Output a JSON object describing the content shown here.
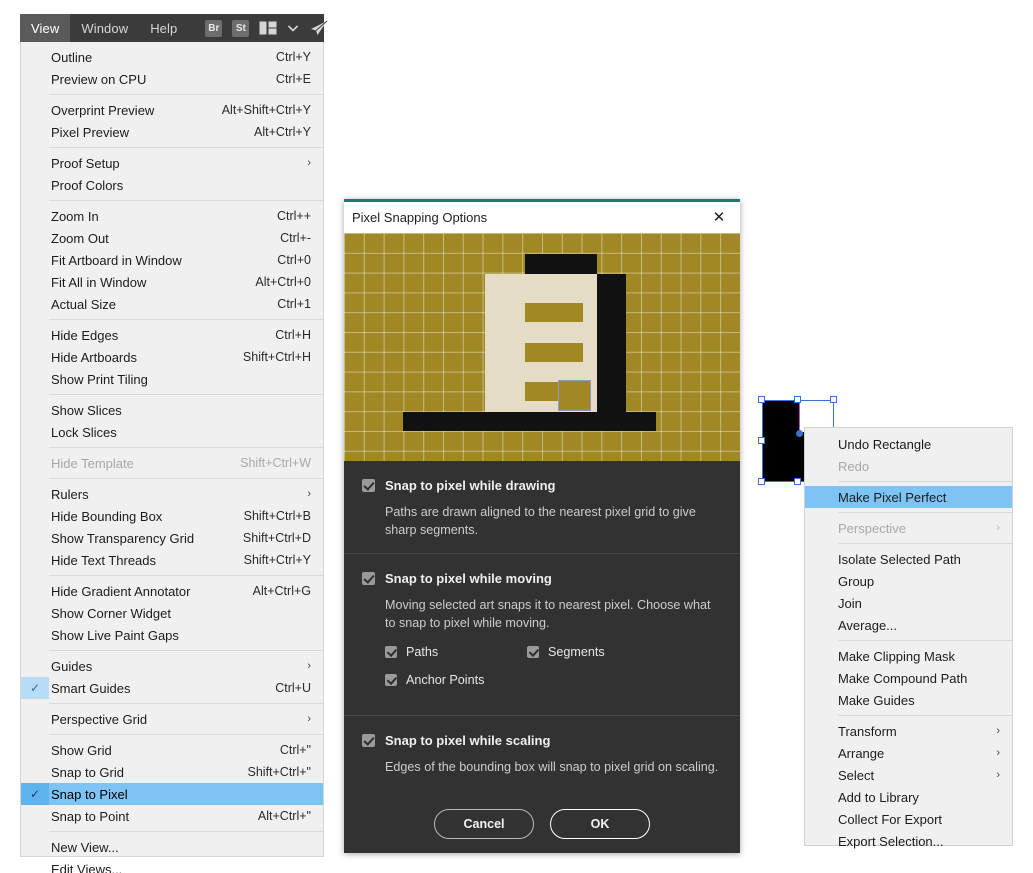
{
  "menubar": {
    "items": [
      {
        "label": "View",
        "active": true
      },
      {
        "label": "Window",
        "active": false
      },
      {
        "label": "Help",
        "active": false
      }
    ],
    "icons": [
      {
        "name": "bridge-icon",
        "label": "Br"
      },
      {
        "name": "stock-icon",
        "label": "St"
      },
      {
        "name": "arrange-documents-icon",
        "label": ""
      },
      {
        "name": "chevron-down-icon",
        "label": "⌄"
      },
      {
        "name": "share-rocket-icon",
        "label": ""
      }
    ]
  },
  "view_menu": {
    "groups": [
      [
        {
          "label": "Outline",
          "accel": "Ctrl+Y"
        },
        {
          "label": "Preview on CPU",
          "accel": "Ctrl+E"
        }
      ],
      [
        {
          "label": "Overprint Preview",
          "accel": "Alt+Shift+Ctrl+Y"
        },
        {
          "label": "Pixel Preview",
          "accel": "Alt+Ctrl+Y"
        }
      ],
      [
        {
          "label": "Proof Setup",
          "accel": "",
          "submenu": true
        },
        {
          "label": "Proof Colors",
          "accel": ""
        }
      ],
      [
        {
          "label": "Zoom In",
          "accel": "Ctrl++"
        },
        {
          "label": "Zoom Out",
          "accel": "Ctrl+-"
        },
        {
          "label": "Fit Artboard in Window",
          "accel": "Ctrl+0"
        },
        {
          "label": "Fit All in Window",
          "accel": "Alt+Ctrl+0"
        },
        {
          "label": "Actual Size",
          "accel": "Ctrl+1"
        }
      ],
      [
        {
          "label": "Hide Edges",
          "accel": "Ctrl+H"
        },
        {
          "label": "Hide Artboards",
          "accel": "Shift+Ctrl+H"
        },
        {
          "label": "Show Print Tiling",
          "accel": ""
        }
      ],
      [
        {
          "label": "Show Slices",
          "accel": ""
        },
        {
          "label": "Lock Slices",
          "accel": ""
        }
      ],
      [
        {
          "label": "Hide Template",
          "accel": "Shift+Ctrl+W",
          "disabled": true
        }
      ],
      [
        {
          "label": "Rulers",
          "accel": "",
          "submenu": true
        },
        {
          "label": "Hide Bounding Box",
          "accel": "Shift+Ctrl+B"
        },
        {
          "label": "Show Transparency Grid",
          "accel": "Shift+Ctrl+D"
        },
        {
          "label": "Hide Text Threads",
          "accel": "Shift+Ctrl+Y"
        }
      ],
      [
        {
          "label": "Hide Gradient Annotator",
          "accel": "Alt+Ctrl+G"
        },
        {
          "label": "Show Corner Widget",
          "accel": ""
        },
        {
          "label": "Show Live Paint Gaps",
          "accel": ""
        }
      ],
      [
        {
          "label": "Guides",
          "accel": "",
          "submenu": true
        },
        {
          "label": "Smart Guides",
          "accel": "Ctrl+U",
          "checked": true
        }
      ],
      [
        {
          "label": "Perspective Grid",
          "accel": "",
          "submenu": true
        }
      ],
      [
        {
          "label": "Show Grid",
          "accel": "Ctrl+\""
        },
        {
          "label": "Snap to Grid",
          "accel": "Shift+Ctrl+\""
        },
        {
          "label": "Snap to Pixel",
          "accel": "",
          "checked": true,
          "selected": true
        },
        {
          "label": "Snap to Point",
          "accel": "Alt+Ctrl+\""
        }
      ],
      [
        {
          "label": "New View...",
          "accel": ""
        },
        {
          "label": "Edit Views...",
          "accel": ""
        }
      ]
    ]
  },
  "dialog": {
    "title": "Pixel Snapping Options",
    "close_label": "✕",
    "sections": [
      {
        "checkbox_label": "Snap to pixel while drawing",
        "checked": true,
        "description": "Paths are drawn aligned to the nearest pixel grid to give sharp segments."
      },
      {
        "checkbox_label": "Snap to pixel while moving",
        "checked": true,
        "description": "Moving selected art snaps it to nearest pixel. Choose what to snap to pixel while moving.",
        "sub_options": [
          {
            "label": "Paths",
            "checked": true
          },
          {
            "label": "Segments",
            "checked": true
          },
          {
            "label": "Anchor Points",
            "checked": true
          }
        ]
      },
      {
        "checkbox_label": "Snap to pixel while scaling",
        "checked": true,
        "description": "Edges of the bounding box will snap to pixel grid on scaling."
      }
    ],
    "buttons": {
      "cancel": "Cancel",
      "ok": "OK"
    },
    "preview": {
      "background_color": "#a08824",
      "grid_line_color": "#ffffff",
      "building_fill": "#e4dcc4",
      "dark_color": "#111111"
    },
    "accent_color": "#1f7a6e"
  },
  "context_menu": {
    "groups": [
      [
        {
          "label": "Undo Rectangle"
        },
        {
          "label": "Redo",
          "disabled": true
        }
      ],
      [
        {
          "label": "Make Pixel Perfect",
          "selected": true
        }
      ],
      [
        {
          "label": "Perspective",
          "disabled": true,
          "submenu": true
        }
      ],
      [
        {
          "label": "Isolate Selected Path"
        },
        {
          "label": "Group"
        },
        {
          "label": "Join"
        },
        {
          "label": "Average..."
        }
      ],
      [
        {
          "label": "Make Clipping Mask"
        },
        {
          "label": "Make Compound Path"
        },
        {
          "label": "Make Guides"
        }
      ],
      [
        {
          "label": "Transform",
          "submenu": true
        },
        {
          "label": "Arrange",
          "submenu": true
        },
        {
          "label": "Select",
          "submenu": true
        },
        {
          "label": "Add to Library"
        },
        {
          "label": "Collect For Export"
        },
        {
          "label": "Export Selection..."
        }
      ]
    ]
  },
  "colors": {
    "menu_background": "#f0f0f0",
    "menu_highlight": "#7dc4f5",
    "check_column": "#b8dcf5",
    "dialog_background": "#323232",
    "selection_blue": "#3b6fd4",
    "menubar_background": "#3b3b3b"
  }
}
